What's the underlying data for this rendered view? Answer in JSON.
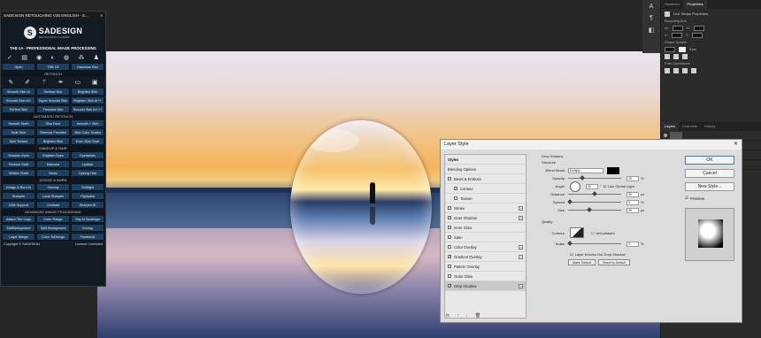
{
  "plugin": {
    "title": "SADESIGN RETOUCHING V25 ENGLISH - S...",
    "close": "×",
    "logo_mark": "S",
    "logo_name": "SADESIGN",
    "logo_sub": "RETOUCHING ACADEMY",
    "tab_title": "TAB 1A - PROFESSIONAL IMAGE PROCESSING",
    "icons": [
      "check-icon",
      "document-icon",
      "filter-icon",
      "exposure-icon",
      "channels-icon",
      "group-icon",
      "user-icon"
    ],
    "row1": [
      "Open",
      "TAB 1D",
      "Gaussian Blur"
    ],
    "retouch_title": "RETOUCH",
    "retouch_tools": [
      "brush-icon",
      "brush-icon",
      "wand-icon",
      "pen-icon",
      "eraser-icon",
      "square-icon"
    ],
    "retouch": [
      "Smooth Skin AI",
      "Surface Blur",
      "Brighten Skin",
      "Smooth Skin AI+",
      "Super Smooth Skin",
      "Brighten Skin AI++",
      "Perfect Skin",
      "Freckled Skin",
      "Smooth Skin AI+++"
    ],
    "auto_title": "AUTOMATIC RETOUCH",
    "auto": [
      "Smooth Teeth",
      "Slim Face",
      "Smooth + Slim",
      "Bulk Skin",
      "Remove Freckles",
      "Skin Color Scales",
      "Skin Texture",
      "Brighten Skin",
      "Even Skin Tone"
    ],
    "makeup_title": "MAKEUP & HAIR",
    "makeup": [
      "Sharpen Eyes",
      "Brighten Eyes",
      "Eyelashes",
      "Reduce Gold",
      "Mascara",
      "Lipstick",
      "Whiten Teeth",
      "Blush",
      "Dyeing Hair"
    ],
    "dodge_title": "DODGE & BURN",
    "dodge": [
      "Dodge & Burn AI",
      "Overlay",
      "Softlight",
      "Sharpen",
      "Local Sharpen",
      "Highpass",
      "D&B Support",
      "Contrast",
      "Sharpen AI"
    ],
    "adv_title": "ADVANCED IMAGE PROCESSING",
    "adv": [
      "Attach The Logo",
      "Color Range",
      "Sky AI Sadesign",
      "EditBackground",
      "Split Background",
      "Ironing",
      "Layer Merge",
      "Color ToDesign",
      "Facebook"
    ],
    "footer_left": "Copyright © SADESIGN",
    "footer_right": "License: Unlimited"
  },
  "tools": [
    "A",
    "¶",
    "◧"
  ],
  "properties": {
    "tabs": [
      "Swatches",
      "Properties"
    ],
    "heading": "Live Shape Properties",
    "bbox_label": "Bounding Box",
    "w_label": "W:",
    "h_label": "H:",
    "x_label": "X:",
    "y_label": "Y:",
    "shape_label": "Shape Details",
    "path_label": "Path Operations",
    "stroke_size": "3 px"
  },
  "layers": {
    "tabs": [
      "Layers",
      "Channels",
      "History"
    ]
  },
  "dialog": {
    "title": "Layer Style",
    "close": "✕",
    "styles_header": "Styles",
    "blending": "Blending Options",
    "styles": [
      {
        "name": "Bevel & Emboss",
        "checked": false,
        "plus": false,
        "indent": false
      },
      {
        "name": "Contour",
        "checked": false,
        "plus": false,
        "indent": true
      },
      {
        "name": "Texture",
        "checked": false,
        "plus": false,
        "indent": true
      },
      {
        "name": "Stroke",
        "checked": false,
        "plus": true,
        "indent": false
      },
      {
        "name": "Inner Shadow",
        "checked": true,
        "plus": true,
        "indent": false
      },
      {
        "name": "Inner Glow",
        "checked": false,
        "plus": false,
        "indent": false
      },
      {
        "name": "Satin",
        "checked": false,
        "plus": false,
        "indent": false
      },
      {
        "name": "Color Overlay",
        "checked": false,
        "plus": true,
        "indent": false
      },
      {
        "name": "Gradient Overlay",
        "checked": true,
        "plus": true,
        "indent": false
      },
      {
        "name": "Pattern Overlay",
        "checked": false,
        "plus": false,
        "indent": false
      },
      {
        "name": "Outer Glow",
        "checked": false,
        "plus": false,
        "indent": false
      },
      {
        "name": "Drop Shadow",
        "checked": true,
        "plus": true,
        "indent": false,
        "selected": true
      }
    ],
    "drop_shadow": "Drop Shadow",
    "structure": "Structure",
    "blend_mode_label": "Blend Mode:",
    "blend_mode": "Multiply",
    "opacity_label": "Opacity:",
    "opacity": "25",
    "opacity_frac": 0.25,
    "angle_label": "Angle:",
    "angle": "30",
    "global_light": "Use Global Light",
    "distance_label": "Distance:",
    "distance": "50",
    "distance_frac": 0.5,
    "spread_label": "Spread:",
    "spread": "0",
    "spread_frac": 0.0,
    "size_label": "Size:",
    "size": "98",
    "size_frac": 0.39,
    "quality": "Quality",
    "contour_label": "Contour:",
    "antialiased": "Anti-aliased",
    "noise_label": "Noise:",
    "noise": "0",
    "noise_frac": 0.0,
    "knockout": "Layer Knocks Out Drop Shadow",
    "make_default": "Make Default",
    "reset_default": "Reset to Default",
    "pct": "%",
    "px": "px",
    "deg": "°",
    "ok": "OK",
    "cancel": "Cancel",
    "new_style": "New Style...",
    "preview": "Preview",
    "bottom_icons": [
      "fx",
      "↑",
      "↓",
      "🗑"
    ]
  }
}
